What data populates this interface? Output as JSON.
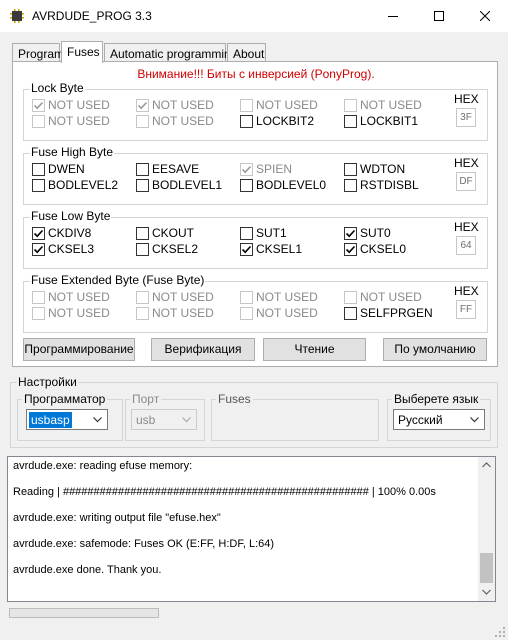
{
  "window": {
    "title": "AVRDUDE_PROG 3.3"
  },
  "tabs": [
    {
      "label": "Program",
      "active": false
    },
    {
      "label": "Fuses",
      "active": true
    },
    {
      "label": "Automatic programming",
      "active": false
    },
    {
      "label": "About",
      "active": false
    }
  ],
  "warning": "Внимание!!! Биты с инверсией (PonyProg).",
  "groups": [
    {
      "title": "Lock Byte",
      "hex_label": "HEX",
      "hex_value": "3F",
      "rows": [
        [
          {
            "label": "NOT USED",
            "checked": true,
            "enabled": false
          },
          {
            "label": "NOT USED",
            "checked": true,
            "enabled": false
          },
          {
            "label": "NOT USED",
            "checked": false,
            "enabled": false
          },
          {
            "label": "NOT USED",
            "checked": false,
            "enabled": false
          }
        ],
        [
          {
            "label": "NOT USED",
            "checked": false,
            "enabled": false
          },
          {
            "label": "NOT USED",
            "checked": false,
            "enabled": false
          },
          {
            "label": "LOCKBIT2",
            "checked": false,
            "enabled": true
          },
          {
            "label": "LOCKBIT1",
            "checked": false,
            "enabled": true
          }
        ]
      ]
    },
    {
      "title": "Fuse High Byte",
      "hex_label": "HEX",
      "hex_value": "DF",
      "rows": [
        [
          {
            "label": "DWEN",
            "checked": false,
            "enabled": true
          },
          {
            "label": "EESAVE",
            "checked": false,
            "enabled": true
          },
          {
            "label": "SPIEN",
            "checked": true,
            "enabled": false
          },
          {
            "label": "WDTON",
            "checked": false,
            "enabled": true
          }
        ],
        [
          {
            "label": "BODLEVEL2",
            "checked": false,
            "enabled": true
          },
          {
            "label": "BODLEVEL1",
            "checked": false,
            "enabled": true
          },
          {
            "label": "BODLEVEL0",
            "checked": false,
            "enabled": true
          },
          {
            "label": "RSTDISBL",
            "checked": false,
            "enabled": true
          }
        ]
      ]
    },
    {
      "title": "Fuse Low Byte",
      "hex_label": "HEX",
      "hex_value": "64",
      "rows": [
        [
          {
            "label": "CKDIV8",
            "checked": true,
            "enabled": true
          },
          {
            "label": "CKOUT",
            "checked": false,
            "enabled": true
          },
          {
            "label": "SUT1",
            "checked": false,
            "enabled": true
          },
          {
            "label": "SUT0",
            "checked": true,
            "enabled": true
          }
        ],
        [
          {
            "label": "CKSEL3",
            "checked": true,
            "enabled": true
          },
          {
            "label": "CKSEL2",
            "checked": false,
            "enabled": true
          },
          {
            "label": "CKSEL1",
            "checked": true,
            "enabled": true
          },
          {
            "label": "CKSEL0",
            "checked": true,
            "enabled": true
          }
        ]
      ]
    },
    {
      "title": "Fuse Extended Byte (Fuse Byte)",
      "hex_label": "HEX",
      "hex_value": "FF",
      "rows": [
        [
          {
            "label": "NOT USED",
            "checked": false,
            "enabled": false
          },
          {
            "label": "NOT USED",
            "checked": false,
            "enabled": false
          },
          {
            "label": "NOT USED",
            "checked": false,
            "enabled": false
          },
          {
            "label": "NOT USED",
            "checked": false,
            "enabled": false
          }
        ],
        [
          {
            "label": "NOT USED",
            "checked": false,
            "enabled": false
          },
          {
            "label": "NOT USED",
            "checked": false,
            "enabled": false
          },
          {
            "label": "NOT USED",
            "checked": false,
            "enabled": false
          },
          {
            "label": "SELFPRGEN",
            "checked": false,
            "enabled": true
          }
        ]
      ]
    }
  ],
  "buttons": {
    "program": "Программирование",
    "verify": "Верификация",
    "read": "Чтение",
    "default": "По умолчанию"
  },
  "settings": {
    "title": "Настройки",
    "programmer": {
      "label": "Программатор",
      "value": "usbasp"
    },
    "port": {
      "label": "Порт",
      "value": "usb"
    },
    "fuses": {
      "label": "Fuses"
    },
    "language": {
      "label": "Выберете язык",
      "value": "Русский"
    }
  },
  "log": [
    "avrdude.exe: reading efuse memory:",
    "Reading | ################################################## | 100% 0.00s",
    "avrdude.exe: writing output file \"efuse.hex\"",
    "avrdude.exe: safemode: Fuses OK (E:FF, H:DF, L:64)",
    "avrdude.exe done.  Thank you."
  ],
  "icons": {
    "app": "chip-icon",
    "check": "checkmark-icon"
  }
}
